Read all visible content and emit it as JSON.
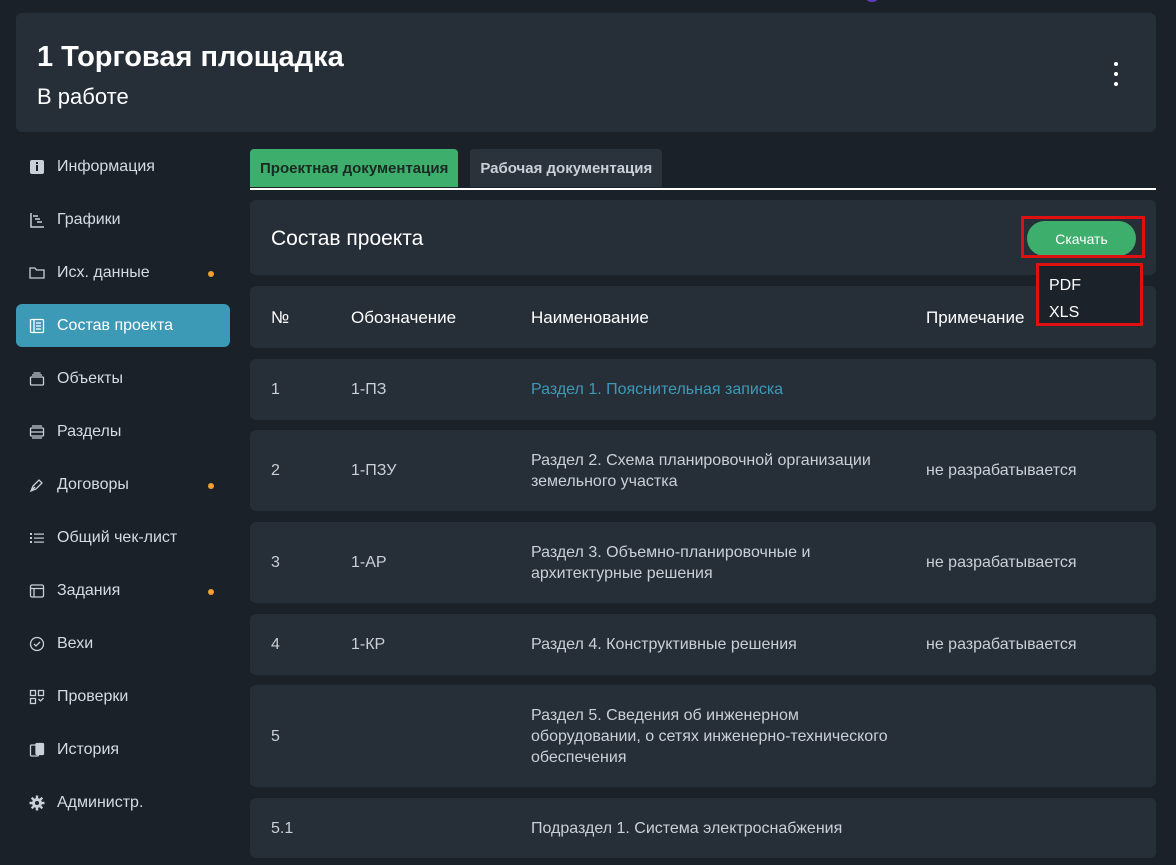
{
  "header": {
    "title": "1 Торговая площадка",
    "subtitle": "В работе"
  },
  "sidebar": {
    "items": [
      {
        "label": "Информация",
        "icon": "info-icon",
        "dot": false
      },
      {
        "label": "Графики",
        "icon": "gantt-chart-icon",
        "dot": false
      },
      {
        "label": "Исх. данные",
        "icon": "folder-icon",
        "dot": true
      },
      {
        "label": "Состав проекта",
        "icon": "document-list-icon",
        "dot": false,
        "active": true
      },
      {
        "label": "Объекты",
        "icon": "stack-icon",
        "dot": false
      },
      {
        "label": "Разделы",
        "icon": "sections-icon",
        "dot": false
      },
      {
        "label": "Договоры",
        "icon": "pen-icon",
        "dot": true
      },
      {
        "label": "Общий чек-лист",
        "icon": "checklist-icon",
        "dot": false
      },
      {
        "label": "Задания",
        "icon": "tasks-icon",
        "dot": true
      },
      {
        "label": "Вехи",
        "icon": "check-circle-icon",
        "dot": false
      },
      {
        "label": "Проверки",
        "icon": "grid-icon",
        "dot": false
      },
      {
        "label": "История",
        "icon": "history-icon",
        "dot": false
      },
      {
        "label": "Администр.",
        "icon": "gear-icon",
        "dot": false
      }
    ]
  },
  "tabs": [
    {
      "label": "Проектная документация",
      "active": true
    },
    {
      "label": "Рабочая документация",
      "active": false
    }
  ],
  "project": {
    "title": "Состав проекта",
    "download_label": "Скачать",
    "download_options": [
      "PDF",
      "XLS"
    ]
  },
  "table": {
    "headers": {
      "num": "№",
      "code": "Обозначение",
      "name": "Наименование",
      "note": "Примечание"
    },
    "rows": [
      {
        "num": "1",
        "code": "1-ПЗ",
        "name": "Раздел 1. Пояснительная записка",
        "note": ""
      },
      {
        "num": "2",
        "code": "1-ПЗУ",
        "name": "Раздел 2. Схема планировочной организации земельного участка",
        "note": "не разрабатывается"
      },
      {
        "num": "3",
        "code": "1-АР",
        "name": "Раздел 3. Объемно-планировочные и архитектурные решения",
        "note": "не разрабатывается"
      },
      {
        "num": "4",
        "code": "1-КР",
        "name": "Раздел 4. Конструктивные решения",
        "note": "не разрабатывается"
      },
      {
        "num": "5",
        "code": "",
        "name": "Раздел 5. Сведения об инженерном оборудовании, о сетях инженерно-технического обеспечения",
        "note": ""
      },
      {
        "num": "5.1",
        "code": "",
        "name": "Подраздел 1. Система электроснабжения",
        "note": ""
      }
    ]
  },
  "colors": {
    "accent_green": "#3dae6c",
    "accent_blue": "#3c9ab6",
    "highlight_red": "#e01010",
    "dot_orange": "#f0a030"
  }
}
